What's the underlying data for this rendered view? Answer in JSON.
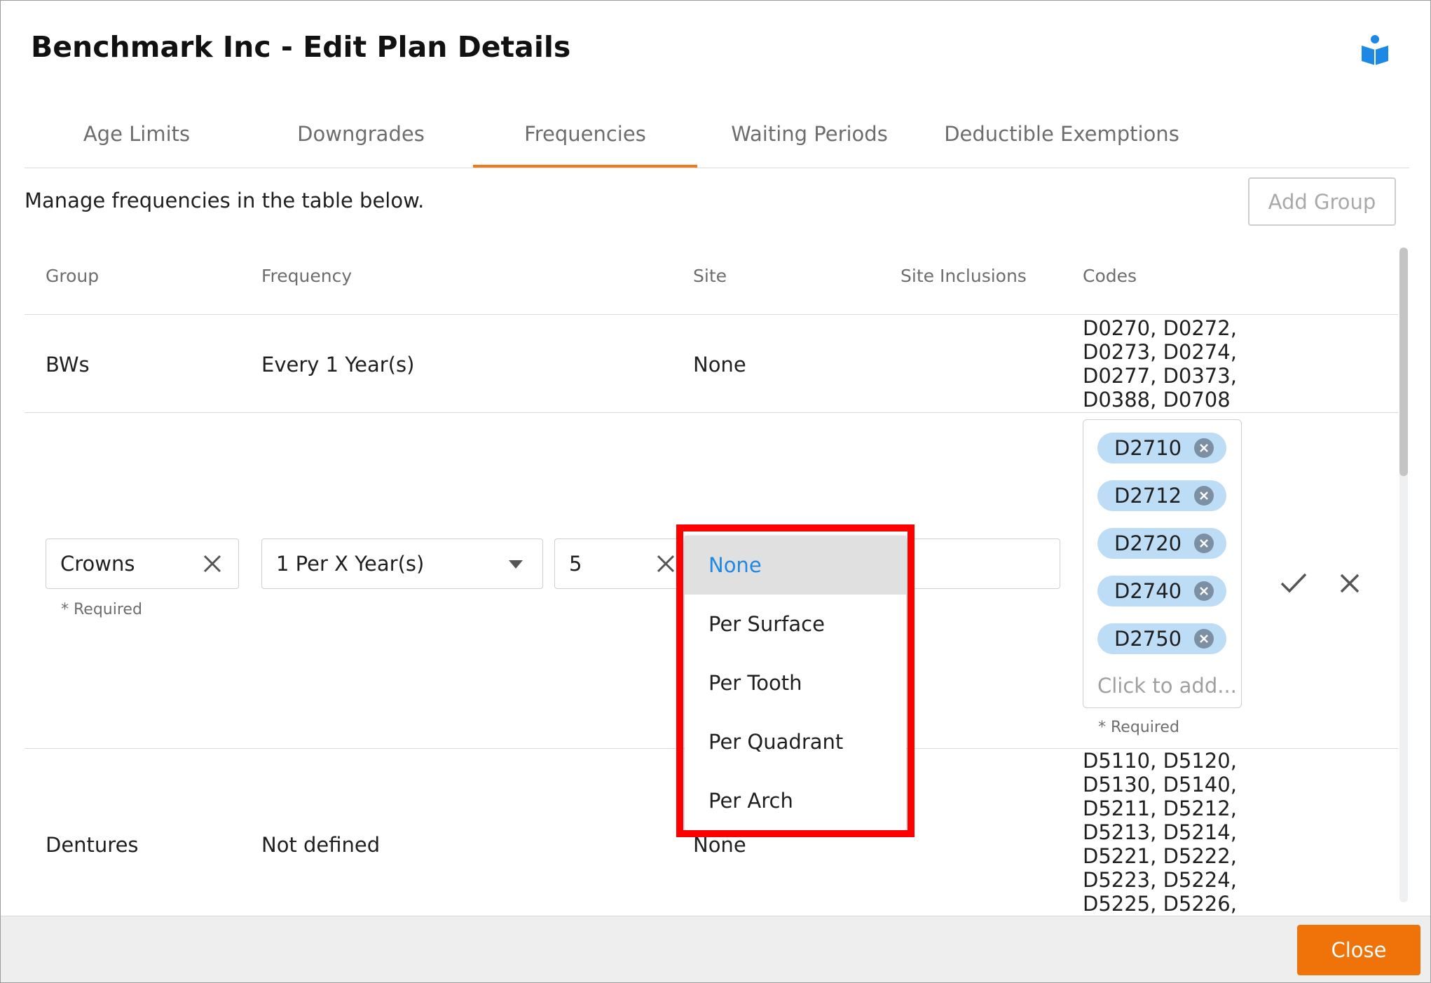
{
  "dialog": {
    "title": "Benchmark Inc - Edit Plan Details"
  },
  "tabs": [
    {
      "label": "Age Limits"
    },
    {
      "label": "Downgrades"
    },
    {
      "label": "Frequencies"
    },
    {
      "label": "Waiting Periods"
    },
    {
      "label": "Deductible Exemptions"
    }
  ],
  "description": "Manage frequencies in the table below.",
  "add_group_label": "Add Group",
  "table": {
    "headers": [
      "Group",
      "Frequency",
      "Site",
      "Site Inclusions",
      "Codes"
    ],
    "rows": [
      {
        "group": "BWs",
        "frequency": "Every 1 Year(s)",
        "site": "None",
        "codes": [
          "D0270, D0272,",
          "D0273, D0274,",
          "D0277, D0373,",
          "D0388, D0708"
        ]
      },
      {
        "group": "Dentures",
        "frequency": "Not defined",
        "site": "None",
        "codes": [
          "D5110, D5120,",
          "D5130, D5140,",
          "D5211, D5212,",
          "D5213, D5214,",
          "D5221, D5222,",
          "D5223, D5224,",
          "D5225, D5226,"
        ]
      }
    ]
  },
  "edit_row": {
    "group_value": "Crowns",
    "frequency_value": "1 Per X Year(s)",
    "years_value": "5",
    "required_label": "* Required",
    "tags": [
      "D2710",
      "D2712",
      "D2720",
      "D2740",
      "D2750"
    ],
    "tags_placeholder": "Click to add...",
    "site_options": [
      "None",
      "Per Surface",
      "Per Tooth",
      "Per Quadrant",
      "Per Arch"
    ],
    "selected_site": "None"
  },
  "close_label": "Close",
  "colors": {
    "accent": "#f07309",
    "tag": "#bddcf6",
    "highlight": "#ff0000",
    "selected_option_text": "#1e88e5"
  }
}
